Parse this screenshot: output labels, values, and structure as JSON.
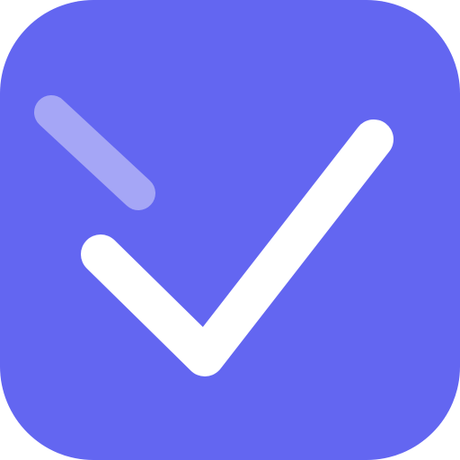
{
  "icon": {
    "name": "checkmark-app-icon",
    "colors": {
      "background": "#6366F1",
      "check": "#FFFFFF",
      "accent_stroke": "#A5A6F6"
    }
  }
}
